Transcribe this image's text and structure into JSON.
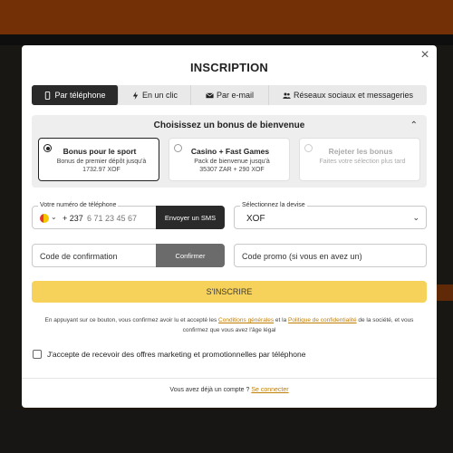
{
  "modal": {
    "title": "INSCRIPTION",
    "close_glyph": "×"
  },
  "tabs": [
    {
      "label": "Par téléphone",
      "icon": "phone-icon",
      "active": true
    },
    {
      "label": "En un clic",
      "icon": "lightning-icon",
      "active": false
    },
    {
      "label": "Par e-mail",
      "icon": "envelope-icon",
      "active": false
    },
    {
      "label": "Réseaux sociaux et messageries",
      "icon": "people-icon",
      "active": false
    }
  ],
  "bonus": {
    "heading": "Choisissez un bonus de bienvenue",
    "options": [
      {
        "title": "Bonus pour le sport",
        "desc_line1": "Bonus de premier dépôt jusqu'à",
        "desc_line2": "1732.97",
        "currency": "XOF",
        "selected": true
      },
      {
        "title": "Casino + Fast Games",
        "desc_line1": "Pack de bienvenue jusqu'à",
        "desc_line2": "35307 ZAR + 290",
        "currency": "XOF",
        "selected": false
      },
      {
        "title": "Rejeter les bonus",
        "desc_line1": "Faites votre sélection plus tard",
        "selected": false
      }
    ]
  },
  "phone": {
    "label": "Votre numéro de téléphone",
    "country_code": "+ 237",
    "placeholder": "6 71 23 45 67",
    "send_sms_label": "Envoyer un SMS"
  },
  "currency": {
    "label": "Sélectionnez la devise",
    "value": "XOF"
  },
  "confirmation": {
    "placeholder": "Code de confirmation",
    "confirm_label": "Confirmer"
  },
  "promo": {
    "placeholder": "Code promo (si vous en avez un)"
  },
  "submit_label": "S'INSCRIRE",
  "legal": {
    "part1": "En appuyant sur ce bouton, vous confirmez avoir lu et accepté les ",
    "terms_link": "Conditions générales",
    "part2": " et la ",
    "privacy_link": "Politique de confidentialité",
    "part3": " de la société, et vous confirmez que vous avez l'âge légal"
  },
  "marketing_checkbox_label": "J'accepte de recevoir des offres marketing et promotionnelles par téléphone",
  "footer": {
    "question": "Vous avez déjà un compte ? ",
    "login_link": "Se connecter"
  },
  "colors": {
    "accent_yellow": "#f7d25a",
    "link_gold": "#c07d00",
    "dark_button": "#2a2a2a",
    "brand_orange": "#d2570a"
  }
}
